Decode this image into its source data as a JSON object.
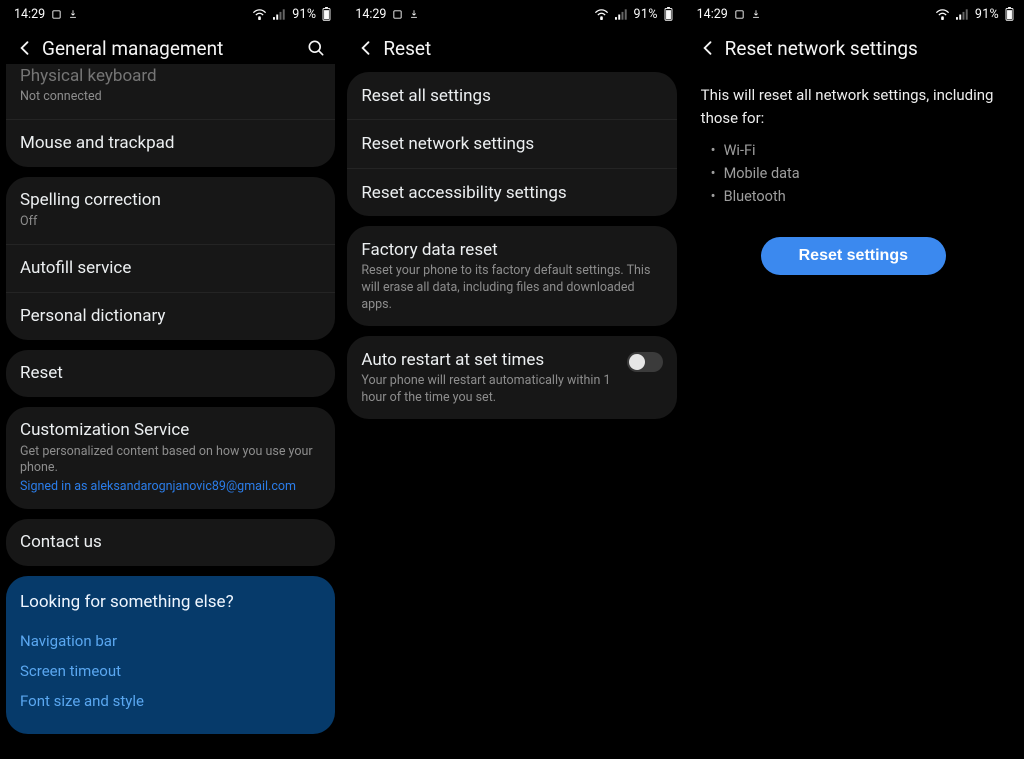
{
  "status": {
    "time": "14:29",
    "battery_pct": "91%"
  },
  "pane1": {
    "title": "General management",
    "group_top": {
      "physical_keyboard": {
        "label": "Physical keyboard",
        "sub": "Not connected"
      },
      "mouse_trackpad": "Mouse and trackpad"
    },
    "group_text": {
      "spelling": {
        "label": "Spelling correction",
        "sub": "Off"
      },
      "autofill": "Autofill service",
      "dictionary": "Personal dictionary"
    },
    "reset": "Reset",
    "customization": {
      "label": "Customization Service",
      "sub": "Get personalized content based on how you use your phone.",
      "signed_in": "Signed in as aleksandarognjanovic89@gmail.com"
    },
    "contact": "Contact us",
    "help": {
      "title": "Looking for something else?",
      "links": {
        "nav": "Navigation bar",
        "timeout": "Screen timeout",
        "font": "Font size and style"
      }
    }
  },
  "pane2": {
    "title": "Reset",
    "reset_all": "Reset all settings",
    "reset_network": "Reset network settings",
    "reset_accessibility": "Reset accessibility settings",
    "factory": {
      "label": "Factory data reset",
      "sub": "Reset your phone to its factory default settings. This will erase all data, including files and downloaded apps."
    },
    "auto_restart": {
      "label": "Auto restart at set times",
      "sub": "Your phone will restart automatically within 1 hour of the time you set."
    }
  },
  "pane3": {
    "title": "Reset network settings",
    "desc": "This will reset all network settings, including those for:",
    "items": {
      "wifi": "Wi-Fi",
      "mobile": "Mobile data",
      "bt": "Bluetooth"
    },
    "button": "Reset settings"
  }
}
